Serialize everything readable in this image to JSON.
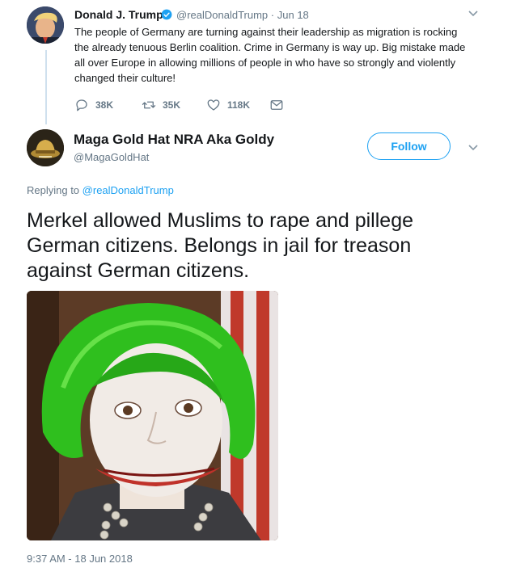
{
  "parent_tweet": {
    "name": "Donald J. Trump",
    "handle": "@realDonaldTrump",
    "separator": "·",
    "date": "Jun 18",
    "text": "The people of Germany are turning against their leadership as migration is rocking the already tenuous Berlin coalition. Crime in Germany is way up. Big mistake made all over Europe in allowing millions of people in who have so strongly and violently changed their culture!",
    "actions": {
      "reply_count": "38K",
      "retweet_count": "35K",
      "like_count": "118K"
    }
  },
  "reply_tweet": {
    "name": "Maga Gold Hat NRA Aka Goldy",
    "handle": "@MagaGoldHat",
    "follow_label": "Follow",
    "replying_prefix": "Replying to",
    "replying_to": "@realDonaldTrump",
    "text": "Merkel allowed Muslims to rape and pillege German citizens. Belongs in jail for treason against German citizens.",
    "timestamp": "9:37 AM - 18 Jun 2018"
  },
  "colors": {
    "accent": "#1da1f2",
    "muted": "#657786",
    "text": "#14171a"
  }
}
